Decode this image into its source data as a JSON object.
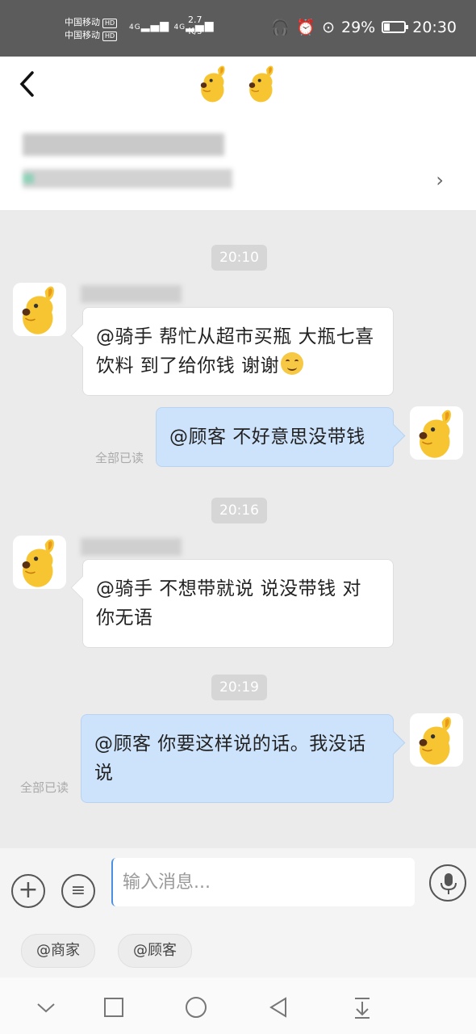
{
  "status_bar": {
    "carrier1": "中国移动",
    "carrier2": "中国移动",
    "hd": "HD",
    "net": "4G",
    "speed_value": "2.7",
    "speed_unit": "K/s",
    "battery_percent": "29%",
    "battery_level": 0.29,
    "time": "20:30"
  },
  "header": {
    "back_label": "<",
    "mascot_icon": "kangaroo-mascot-icon",
    "chevron": "›"
  },
  "chat": {
    "messages": [
      {
        "time": "20:10",
        "direction": "in",
        "text": "@骑手 帮忙从超市买瓶 大瓶七喜 饮料 到了给你钱 谢谢",
        "emoji": "smile-emoji"
      },
      {
        "direction": "out",
        "text": "@顾客 不好意思没带钱",
        "read_status": "全部已读"
      },
      {
        "time": "20:16",
        "direction": "in",
        "text": "@骑手 不想带就说 说没带钱 对你无语"
      },
      {
        "time": "20:19",
        "direction": "out",
        "text": "@顾客 你要这样说的话。我没话说",
        "read_status": "全部已读"
      }
    ]
  },
  "input": {
    "placeholder": "输入消息...",
    "quick_tags": [
      "@商家",
      "@顾客"
    ]
  },
  "nav": {
    "icons": [
      "chevron-down-icon",
      "square-icon",
      "circle-home-icon",
      "triangle-back-icon",
      "download-icon"
    ]
  },
  "colors": {
    "out_bubble": "#cde2fb",
    "in_bubble": "#ffffff",
    "mascot_yellow": "#f7c531"
  }
}
